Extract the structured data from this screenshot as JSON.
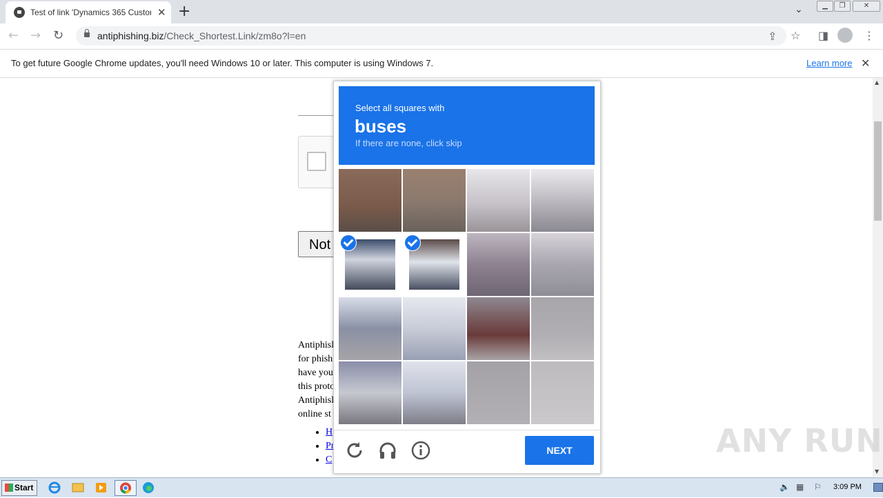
{
  "browser": {
    "tab_title": "Test of link 'Dynamics 365 Customer",
    "url_host": "antiphishing.biz",
    "url_path": "/Check_Shortest.Link/zm8o?l=en"
  },
  "infobar": {
    "message": "To get future Google Chrome updates, you'll need Windows 10 or later. This computer is using Windows 7.",
    "link": "Learn more"
  },
  "page": {
    "button_partial": "Not",
    "paragraph_lines": [
      "Antiphisl",
      "for phish",
      "have you",
      "this proto",
      "Antiphisl",
      "online st"
    ],
    "list_items": [
      "H",
      "Pr",
      "C"
    ]
  },
  "captcha": {
    "instruction": "Select all squares with",
    "target": "buses",
    "subtext": "If there are none, click skip",
    "next_label": "NEXT",
    "selected_tiles": [
      4,
      5
    ]
  },
  "watermark": "ANY RUN",
  "taskbar": {
    "start_label": "Start",
    "clock": "3:09 PM"
  }
}
